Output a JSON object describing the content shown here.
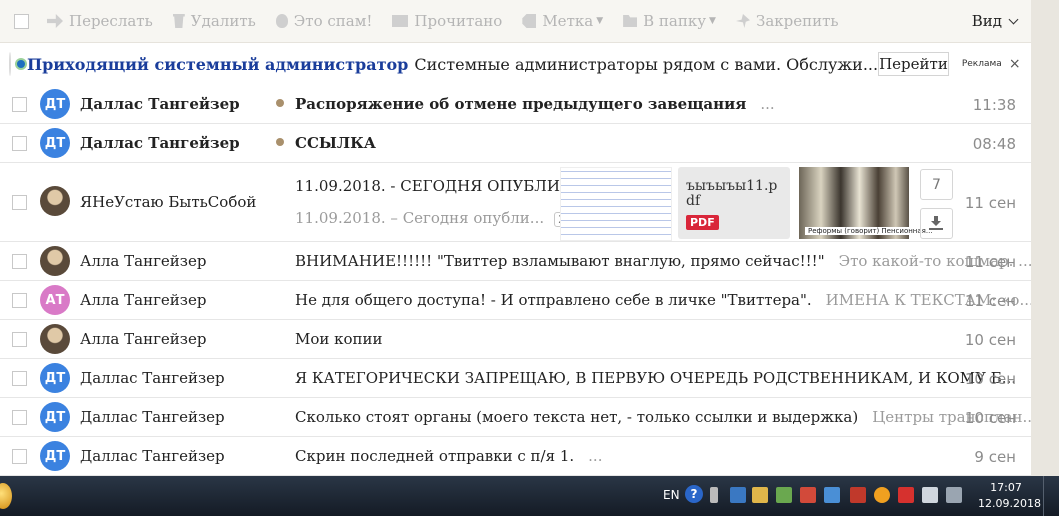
{
  "toolbar": {
    "forward": "Переслать",
    "delete": "Удалить",
    "spam": "Это спам!",
    "read": "Прочитано",
    "label": "Метка",
    "to_folder": "В папку",
    "pin": "Закрепить",
    "view": "Вид"
  },
  "ad": {
    "title": "Приходящий системный администратор",
    "text": "Системные администраторы рядом с вами. Обслужи...",
    "button": "Перейти",
    "ad_label": "Реклама",
    "close": "×"
  },
  "messages": [
    {
      "avatar": "ДТ",
      "avatar_color": "#3b82e0",
      "from": "Даллас Тангейзер",
      "unread": true,
      "subject": "Распоряжение об отмене предыдущего завещания",
      "snippet": "...",
      "date": "11:38"
    },
    {
      "avatar": "ДТ",
      "avatar_color": "#3b82e0",
      "from": "Даллас Тангейзер",
      "unread": true,
      "subject": "ССЫЛКА",
      "snippet": "",
      "date": "08:48"
    },
    {
      "avatar": "",
      "from": "ЯНеУстаю БытьСобой",
      "unread": false,
      "subject": "11.09.2018. - СЕГОДНЯ ОПУБЛИК...",
      "snippet": "11.09.2018. – Сегодня опубли...",
      "thread_count": "2",
      "attachment_pdf_name": "ъыъыъы11.pdf",
      "attachment_pdf_badge": "PDF",
      "thumb_caption": "Реформы (говорит) Пенсионная...",
      "attachments_count": "7",
      "date": "11 сен"
    },
    {
      "avatar": "",
      "from": "Алла Тангейзер",
      "unread": false,
      "subject": "ВНИМАНИЕ!!!!!! \"Твиттер взламывают внаглую, прямо сейчас!!!\"",
      "snippet": "Это какой-то кошмар. ...",
      "date": "11 сен"
    },
    {
      "avatar": "АТ",
      "avatar_color": "#d97ac7",
      "from": "Алла Тангейзер",
      "unread": false,
      "subject": "Не для общего доступа! - И отправлено себе в личке \"Твиттера\".",
      "snippet": "ИМЕНА К ТЕКСТАМ: «о...",
      "date": "11 сен"
    },
    {
      "avatar": "",
      "from": "Алла Тангейзер",
      "unread": false,
      "subject": "Мои копии",
      "snippet": "",
      "date": "10 сен"
    },
    {
      "avatar": "ДТ",
      "avatar_color": "#3b82e0",
      "from": "Даллас Тангейзер",
      "unread": false,
      "subject": "Я КАТЕГОРИЧЕСКИ ЗАПРЕЩАЮ, В ПЕРВУЮ ОЧЕРЕДЬ РОДСТВЕННИКАМ, И КОМУ Б...",
      "snippet": "",
      "date": "10 сен"
    },
    {
      "avatar": "ДТ",
      "avatar_color": "#3b82e0",
      "from": "Даллас Тангейзер",
      "unread": false,
      "subject": "Сколько стоят органы (моего текста нет, - только ссылки и выдержка)",
      "snippet": "Центры трансплан...",
      "date": "10 сен"
    },
    {
      "avatar": "ДТ",
      "avatar_color": "#3b82e0",
      "from": "Даллас Тангейзер",
      "unread": false,
      "subject": "Скрин последней отправки с п/я 1.",
      "snippet": "...",
      "date": "9 сен"
    }
  ],
  "taskbar": {
    "lang": "EN",
    "help": "?",
    "time": "17:07",
    "date": "12.09.2018"
  }
}
